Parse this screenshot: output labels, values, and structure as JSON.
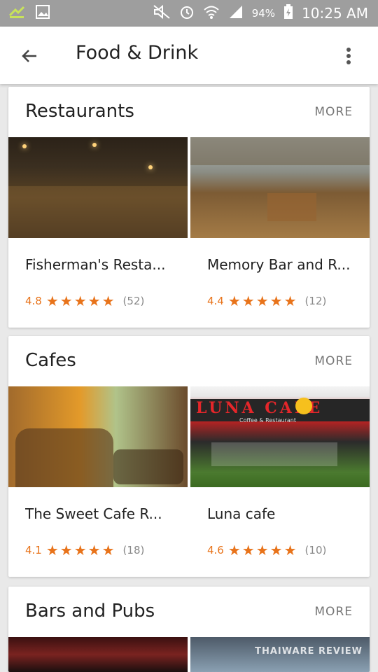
{
  "status_bar": {
    "battery": "94%",
    "time": "10:25 AM"
  },
  "app_bar": {
    "title": "Food & Drink"
  },
  "sections": [
    {
      "title": "Restaurants",
      "more_label": "MORE",
      "items": [
        {
          "name": "Fisherman's Resta...",
          "rating": "4.8",
          "count": "(52)"
        },
        {
          "name": "Memory Bar and R...",
          "rating": "4.4",
          "count": "(12)"
        }
      ]
    },
    {
      "title": "Cafes",
      "more_label": "MORE",
      "items": [
        {
          "name": "The Sweet Cafe R...",
          "rating": "4.1",
          "count": "(18)"
        },
        {
          "name": "Luna cafe",
          "rating": "4.6",
          "count": "(10)"
        }
      ]
    },
    {
      "title": "Bars and Pubs",
      "more_label": "MORE"
    }
  ],
  "image_text": {
    "luna_sign": "LUNA CAFE",
    "luna_sub": "Coffee & Restaurant",
    "watermark": "THAIWARE REVIEW"
  },
  "colors": {
    "accent_orange": "#e8731a",
    "status_bar_bg": "#9e9e9e",
    "page_bg": "#e9e9e9"
  }
}
